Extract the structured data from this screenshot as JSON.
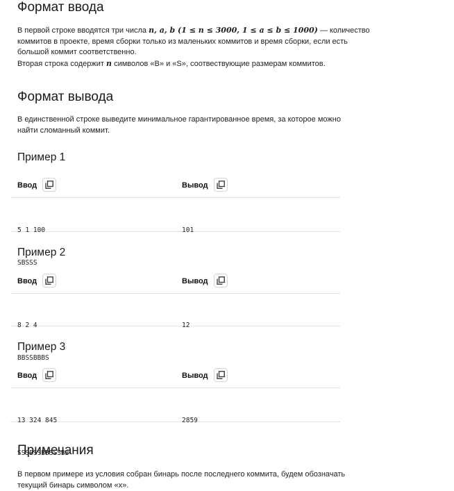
{
  "input_format": {
    "title": "Формат ввода",
    "line1_prefix": "В первой строке вводятся три числа ",
    "math_vars": "n, a, b",
    "math_constraints": " (1 ≤ n ≤ 3000, 1 ≤ a ≤ b ≤ 1000)",
    "line1_suffix": " — количество",
    "line2": "коммитов в проекте, время сборки только из маленьких коммитов и время сборки, если есть",
    "line3": "большой коммит соответственно.",
    "line4_prefix": "Вторая строка содержит ",
    "line4_var": "n",
    "line4_suffix": " символов «B» и «S», соотвествующие размерам коммитов."
  },
  "output_format": {
    "title": "Формат вывода",
    "line1": "В единственной строке выведите минимальное гарантированное время, за которое можно",
    "line2": "найти сломанный коммит."
  },
  "labels": {
    "input": "Ввод",
    "output": "Вывод"
  },
  "examples": [
    {
      "title": "Пример 1",
      "input_lines": [
        "5 1 100",
        "SBSSS"
      ],
      "output_lines": [
        "101"
      ]
    },
    {
      "title": "Пример 2",
      "input_lines": [
        "8 2 4",
        "BBSSBBBS"
      ],
      "output_lines": [
        "12"
      ]
    },
    {
      "title": "Пример 3",
      "input_lines": [
        "13 324 845",
        "SSSBSSBBSSSBB"
      ],
      "output_lines": [
        "2859"
      ]
    }
  ],
  "notes": {
    "title": "Примечания",
    "line1": "В первом примере из условия собран бинарь после последнего коммита, будем обозначать",
    "line2": "текущий бинарь символом «x»."
  }
}
